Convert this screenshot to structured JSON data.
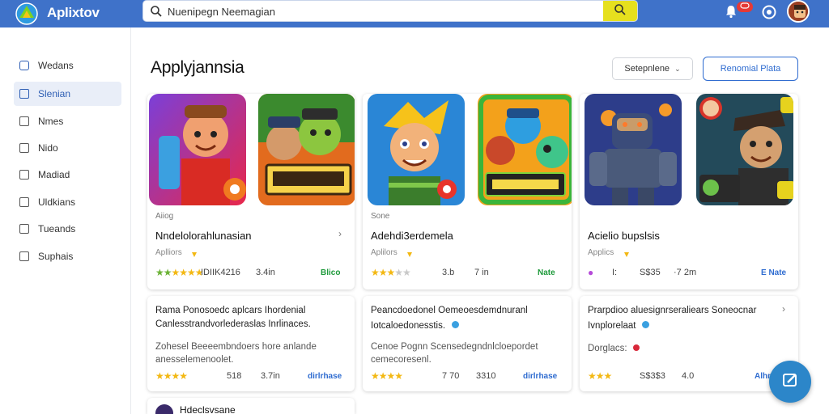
{
  "header": {
    "app_name": "Aplixtov",
    "search_placeholder": "",
    "search_value": "Nuenipegn Neemagian",
    "notification_count": "",
    "colors": {
      "topbar": "#3f72c9",
      "search_button": "#e6e01e",
      "badge": "#e53935"
    },
    "icons": [
      "logo-icon",
      "search-icon",
      "bell-icon",
      "help-icon",
      "avatar"
    ]
  },
  "sidebar": {
    "items": [
      {
        "label": "Wedans",
        "active": false
      },
      {
        "label": "Slenian",
        "active": true
      },
      {
        "label": "Nmes",
        "active": false
      },
      {
        "label": "Nido",
        "active": false
      },
      {
        "label": "Madiad",
        "active": false
      },
      {
        "label": "Uldkians",
        "active": false
      },
      {
        "label": "Tueands",
        "active": false
      },
      {
        "label": "Suphais",
        "active": false
      }
    ]
  },
  "main": {
    "title": "Applyjannsia",
    "sort_label": "Setepnlene",
    "filter_label": "Renomial Plata",
    "top_cards": [
      {
        "category": "Aiiog",
        "title": "Nndelolorahlunasian",
        "developer": "Aplliors",
        "rating_stars": "★★★★",
        "meta1": "IDIIK4216",
        "meta2": "3.4in",
        "tag": "Blico"
      },
      {
        "category": "Sone",
        "title": "Adehdi3erdemela",
        "developer": "Aplilors",
        "rating_stars": "★★★",
        "meta1": "3.b",
        "meta2": "7 in",
        "tag": "Nate"
      },
      {
        "category": "",
        "title": "Acielio bupslsis",
        "developer": "Applics",
        "rating_stars": "●",
        "meta1": "S$35",
        "meta2": "·7 2m",
        "tag": "E Nate"
      }
    ],
    "bottom_cards": [
      {
        "line1": "Rama Ponosoedc aplcars Ihordenial",
        "line2": "Canlesstrandvorlederaslas Inrlinaces.",
        "line3": "Zohesel Beeeembndoers hore anlande",
        "line4": "anesselemenoolet.",
        "rating_stars": "★★★★",
        "meta1": "518",
        "meta2": "3.7in",
        "tag": "dirlrhase"
      },
      {
        "line1": "Peancdoedonel Oemeoesdemdnuranl",
        "line2": "Iotcaloedonesstis.",
        "line3": "Cenoe Pognn Scensedegndnlcloepordet",
        "line4": "cemecoresenl.",
        "rating_stars": "★★★★",
        "meta1": "7 70",
        "meta2": "3310",
        "tag": "dirlrhase"
      },
      {
        "line1": "Prarpdioo aluesignrseraliears Soneocnar",
        "line2": "Ivnplorelaat",
        "line3": "Dorglacs:",
        "line4": "",
        "rating_stars": "★★★",
        "meta1": "S$3$3",
        "meta2": "4.0",
        "tag": "Alhn"
      }
    ],
    "partial_card_title": "Hdeclsvsane"
  }
}
